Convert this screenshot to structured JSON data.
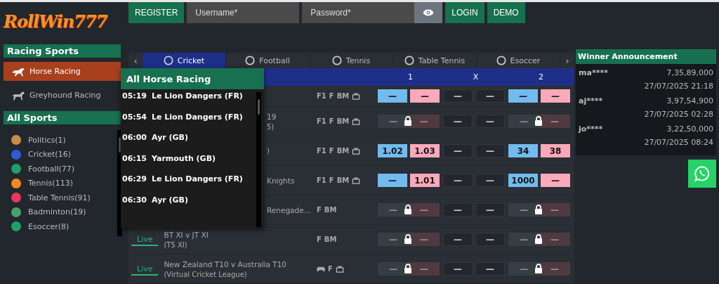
{
  "logo": {
    "text": "RollWin777"
  },
  "top_bar": {
    "register": "REGISTER",
    "username": {
      "placeholder": "Username*"
    },
    "password": {
      "placeholder": "Password*"
    },
    "login": "LOGIN",
    "demo": "DEMO"
  },
  "sidebar": {
    "racing_title": "Racing Sports",
    "racing_items": [
      {
        "label": "Horse Racing",
        "selected": true
      },
      {
        "label": "Greyhound Racing",
        "selected": false
      }
    ],
    "sports_title": "All Sports",
    "sports_items": [
      {
        "label": "Politics(1)"
      },
      {
        "label": "Cricket(16)"
      },
      {
        "label": "Football(77)"
      },
      {
        "label": "Tennis(113)"
      },
      {
        "label": "Table Tennis(91)"
      },
      {
        "label": "Badminton(19)"
      },
      {
        "label": "Esoccer(8)"
      }
    ]
  },
  "tabs": [
    {
      "label": "Cricket",
      "selected": true
    },
    {
      "label": "Football",
      "selected": false
    },
    {
      "label": "Tennis",
      "selected": false
    },
    {
      "label": "Table Tennis",
      "selected": false
    },
    {
      "label": "Esoccer",
      "selected": false
    }
  ],
  "tab_prev": "‹",
  "tab_next": "›",
  "market_header": [
    "1",
    "X",
    "2"
  ],
  "matches": [
    {
      "tags": [
        "F1",
        "F",
        "BM"
      ],
      "gamepad": false,
      "tv": true,
      "markets": [
        {
          "kind": "open",
          "back": "—",
          "lay": "—"
        },
        {
          "kind": "neutral",
          "back": "—",
          "lay": "—"
        },
        {
          "kind": "open",
          "back": "—",
          "lay": "—"
        }
      ]
    },
    {
      "name": "19",
      "league": "5)",
      "tags": [
        "F1",
        "F",
        "BM"
      ],
      "gamepad": false,
      "tv": true,
      "markets": [
        {
          "kind": "locked",
          "back": "—",
          "lay": "—"
        },
        {
          "kind": "neutral",
          "back": "—",
          "lay": "—"
        },
        {
          "kind": "locked",
          "back": "—",
          "lay": "—"
        }
      ]
    },
    {
      "league": ")",
      "tags": [
        "F1",
        "F",
        "BM"
      ],
      "gamepad": false,
      "tv": true,
      "markets": [
        {
          "kind": "open",
          "back": "1.02",
          "lay": "1.03"
        },
        {
          "kind": "neutral",
          "back": "—",
          "lay": "—"
        },
        {
          "kind": "open",
          "back": "34",
          "lay": "38"
        }
      ]
    },
    {
      "name": "Knights",
      "tags": [
        "F1",
        "F",
        "BM"
      ],
      "gamepad": false,
      "tv": true,
      "markets": [
        {
          "kind": "open",
          "back": "—",
          "lay": "1.01"
        },
        {
          "kind": "neutral",
          "back": "—",
          "lay": "—"
        },
        {
          "kind": "open",
          "back": "1000",
          "lay": "—"
        }
      ]
    },
    {
      "name": "Renegade...",
      "tags": [
        "F",
        "BM"
      ],
      "gamepad": false,
      "tv": false,
      "markets": [
        {
          "kind": "locked",
          "back": "—",
          "lay": "—"
        },
        {
          "kind": "neutral",
          "back": "—",
          "lay": "—"
        },
        {
          "kind": "locked",
          "back": "—",
          "lay": "—"
        }
      ]
    },
    {
      "live": true,
      "live_label": "Live",
      "name": "BT XI v JT XI",
      "league": "(T5 XI)",
      "tags": [
        "F",
        "BM"
      ],
      "gamepad": false,
      "tv": false,
      "markets": [
        {
          "kind": "locked",
          "back": "—",
          "lay": "—"
        },
        {
          "kind": "neutral",
          "back": "—",
          "lay": "—"
        },
        {
          "kind": "locked",
          "back": "—",
          "lay": "—"
        }
      ]
    },
    {
      "live": true,
      "live_label": "Live",
      "name": "New Zealand T10 v Australia T10",
      "league": "(Virtual Cricket League)",
      "tags": [
        "F"
      ],
      "gamepad": true,
      "tv": true,
      "markets": [
        {
          "kind": "locked",
          "back": "—",
          "lay": "—"
        },
        {
          "kind": "neutral",
          "back": "—",
          "lay": "—"
        },
        {
          "kind": "locked",
          "back": "—",
          "lay": "—"
        }
      ]
    }
  ],
  "racing_menu": {
    "title": "All Horse Racing",
    "items": [
      {
        "time": "05:19",
        "venue": "Le Lion Dangers (FR)"
      },
      {
        "time": "05:54",
        "venue": "Le Lion Dangers (FR)"
      },
      {
        "time": "06:00",
        "venue": "Ayr (GB)"
      },
      {
        "time": "06:15",
        "venue": "Yarmouth (GB)"
      },
      {
        "time": "06:29",
        "venue": "Le Lion Dangers (FR)"
      },
      {
        "time": "06:30",
        "venue": "Ayr (GB)"
      }
    ]
  },
  "winners": {
    "title": "Winner Announcement",
    "items": [
      {
        "user": "ma****",
        "amount": "7,35,89,000",
        "date": "27/07/2025 21:18"
      },
      {
        "user": "aj****",
        "amount": "3,97,54,900",
        "date": "27/07/2025 02:28"
      },
      {
        "user": "jo****",
        "amount": "3,22,50,000",
        "date": "27/07/2025 08:24"
      }
    ]
  }
}
